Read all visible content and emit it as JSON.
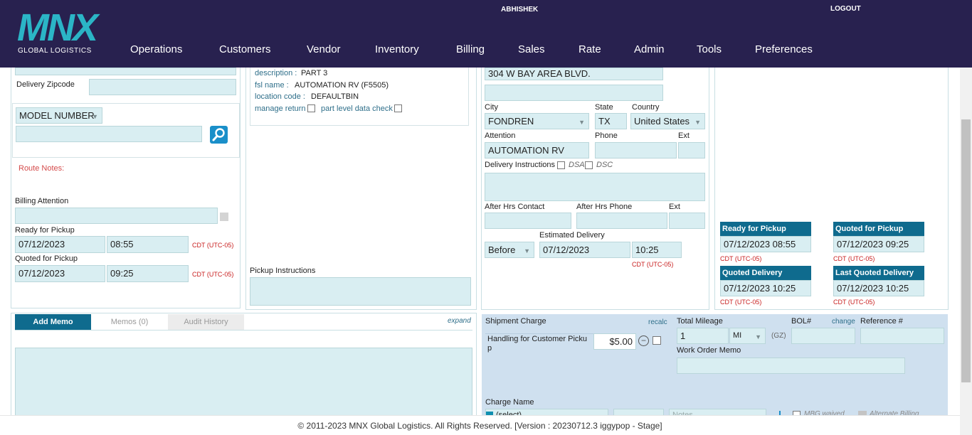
{
  "header": {
    "logo_text": "MNX",
    "logo_sub": "GLOBAL LOGISTICS",
    "user": "ABHISHEK",
    "logout": "LOGOUT",
    "nav": [
      "Operations",
      "Customers",
      "Vendor",
      "Inventory",
      "Billing",
      "Sales",
      "Rate",
      "Admin",
      "Tools",
      "Preferences"
    ],
    "bg_color": "#28214f"
  },
  "left": {
    "delivery_zip_label": "Delivery Zipcode",
    "delivery_zip_value": "",
    "model_select": "MODEL NUMBER",
    "model_search_value": "",
    "route_notes_label": "Route Notes:",
    "billing_attention_label": "Billing Attention",
    "billing_attention_value": "",
    "ready_label": "Ready for Pickup",
    "ready_date": "07/12/2023",
    "ready_time": "08:55",
    "ready_tz": "CDT (UTC-05)",
    "quoted_label": "Quoted for Pickup",
    "quoted_date": "07/12/2023",
    "quoted_time": "09:25",
    "quoted_tz": "CDT (UTC-05)"
  },
  "part": {
    "desc_label": "description :",
    "desc_value": "PART 3",
    "fsl_label": "fsl name :",
    "fsl_value": "AUTOMATION RV (F5505)",
    "loc_label": "location code :",
    "loc_value": "DEFAULTBIN",
    "manage_return": "manage return",
    "part_level": "part level data check",
    "pickup_instr_label": "Pickup Instructions",
    "pickup_instr_value": ""
  },
  "address": {
    "line1": "304 W BAY AREA BLVD.",
    "line2": "",
    "city_label": "City",
    "city": "FONDREN",
    "state_label": "State",
    "state": "TX",
    "country_label": "Country",
    "country": "United States",
    "attention_label": "Attention",
    "attention": "AUTOMATION RV",
    "phone_label": "Phone",
    "phone": "",
    "ext_label": "Ext",
    "ext": "",
    "delivery_instr_label": "Delivery Instructions",
    "dsa": "DSA",
    "dsc": "DSC",
    "after_hrs_contact_label": "After Hrs Contact",
    "after_hrs_phone_label": "After Hrs Phone",
    "after_ext_label": "Ext",
    "est_delivery_label": "Estimated Delivery",
    "before": "Before",
    "est_date": "07/12/2023",
    "est_time": "10:25",
    "est_tz": "CDT (UTC-05)"
  },
  "times": {
    "ready_hdr": "Ready for Pickup",
    "ready_val": "07/12/2023 08:55",
    "ready_tz": "CDT (UTC-05)",
    "quoted_hdr": "Quoted for Pickup",
    "quoted_val": "07/12/2023 09:25",
    "quoted_tz": "CDT (UTC-05)",
    "qdel_hdr": "Quoted Delivery",
    "qdel_val": "07/12/2023 10:25",
    "qdel_tz": "CDT (UTC-05)",
    "lqdel_hdr": "Last Quoted Delivery",
    "lqdel_val": "07/12/2023 10:25",
    "lqdel_tz": "CDT (UTC-05)"
  },
  "memo": {
    "add_memo": "Add Memo",
    "memos_tab": "Memos (0)",
    "audit_tab": "Audit History",
    "expand": "expand"
  },
  "charges": {
    "shipment_charge_label": "Shipment Charge",
    "recalc": "recalc",
    "charge_line_name": "Handling for Customer Pickup",
    "charge_line_amount": "$5.00",
    "total_mileage_label": "Total Mileage",
    "mileage": "1",
    "unit": "MI",
    "gz": "(GZ)",
    "bol_label": "BOL#",
    "change": "change",
    "ref_label": "Reference #",
    "work_order_memo_label": "Work Order Memo",
    "charge_name_label": "Charge Name",
    "charge_select": "(select)",
    "notes_placeholder": "Notes",
    "mbg_waived": "MBG waived",
    "alt_billing": "Alternate Billing"
  },
  "footer": {
    "text": "© 2011-2023 MNX Global Logistics. All Rights Reserved. [Version : 20230712.3 iggypop - Stage]"
  }
}
